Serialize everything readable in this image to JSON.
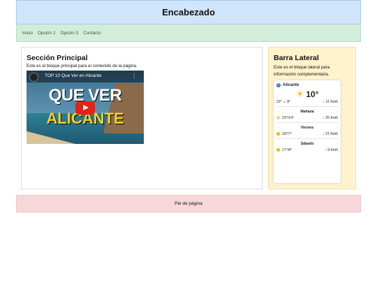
{
  "header": {
    "title": "Encabezado"
  },
  "nav": {
    "items": [
      "Inicio",
      "Opción 2",
      "Opción 3",
      "Contacto"
    ]
  },
  "main": {
    "title": "Sección Principal",
    "text": "Este es el bloque principal para el contenido de la página.",
    "video": {
      "title": "TOP 10 Que Ver en Alicante",
      "more": "⋮",
      "overlay_line1": "QUE VER",
      "overlay_line2": "ALICANTE"
    }
  },
  "sidebar": {
    "title": "Barra Lateral",
    "text": "Este es el bloque lateral para información complementaria.",
    "weather": {
      "city": "Alicante",
      "current_temp": "10°",
      "high_low": "22° ⊥ 8°",
      "wind_now": "↓ 11 Kmh",
      "days": [
        {
          "name": "Mañana",
          "temps": "23°/14°",
          "wind": "↓ 25 Kmh"
        },
        {
          "name": "Viernes",
          "temps": "18°/7°",
          "wind": "↓ 21 Kmh"
        },
        {
          "name": "Sábado",
          "temps": "17°/8°",
          "wind": "↓ 9 Kmh"
        }
      ]
    }
  },
  "footer": {
    "text": "Pie de página"
  }
}
